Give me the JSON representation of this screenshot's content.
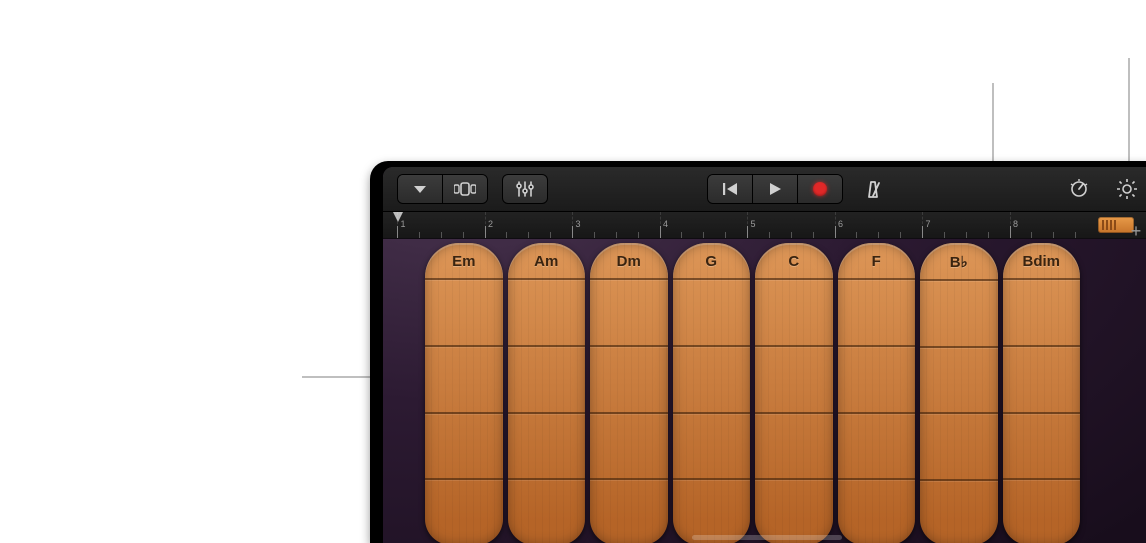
{
  "toolbar": {
    "view_menu": "view-menu",
    "browser": "sound-browser",
    "track_controls": "track-controls",
    "rewind": "go-to-beginning",
    "play": "play",
    "record": "record",
    "metronome": "metronome",
    "autoplay_dial": "autoplay-dial",
    "settings": "settings",
    "add_track": "+"
  },
  "ruler": {
    "bars": [
      "1",
      "2",
      "3",
      "4",
      "5",
      "6",
      "7",
      "8"
    ]
  },
  "chords": [
    "Em",
    "Am",
    "Dm",
    "G",
    "C",
    "F",
    "B♭",
    "Bdim"
  ],
  "chord_rows": 4
}
